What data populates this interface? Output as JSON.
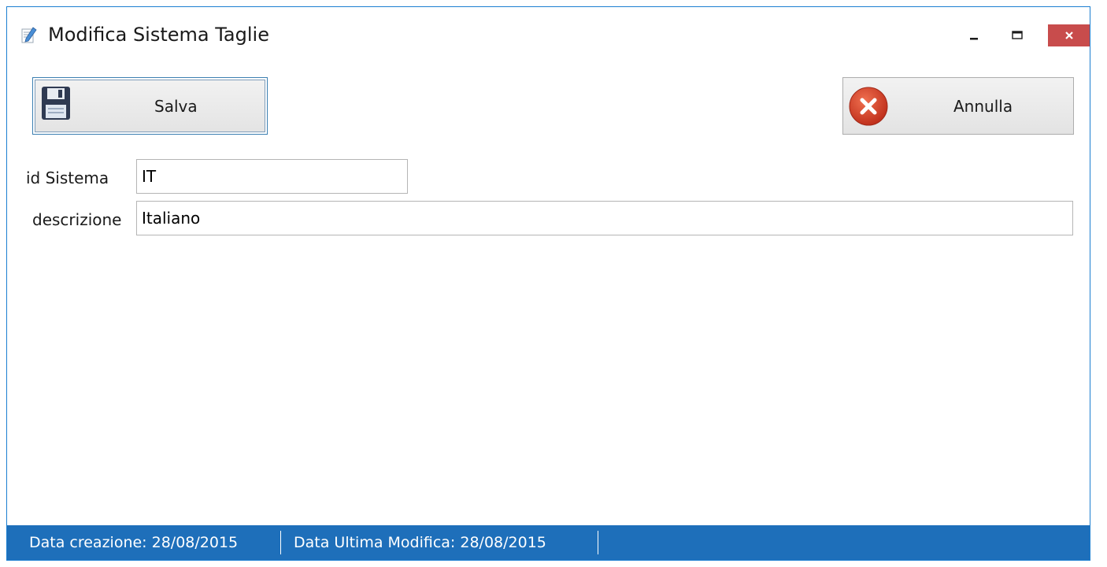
{
  "window": {
    "title": "Modifica Sistema Taglie",
    "controls": {
      "minimize": "minimize",
      "maximize": "maximize",
      "close": "close"
    }
  },
  "toolbar": {
    "save_label": "Salva",
    "cancel_label": "Annulla",
    "save_icon": "floppy-disk-icon",
    "cancel_icon": "cancel-circle-icon"
  },
  "form": {
    "id_label": "id Sistema",
    "id_value": "IT",
    "desc_label": "descrizione",
    "desc_value": "Italiano"
  },
  "status": {
    "created": "Data creazione: 28/08/2015",
    "modified": "Data Ultima Modifica: 28/08/2015"
  },
  "colors": {
    "accent": "#1e6fba",
    "close_button": "#c84c4c",
    "cancel_icon": "#d2402a"
  }
}
